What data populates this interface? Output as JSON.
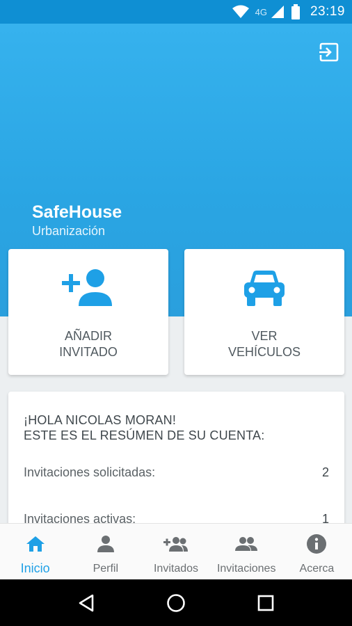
{
  "status_bar": {
    "network": "4G",
    "time": "23:19"
  },
  "header": {
    "app_name": "SafeHouse",
    "subtitle": "Urbanización"
  },
  "actions": [
    {
      "line1": "AÑADIR",
      "line2": "INVITADO",
      "icon": "add-person-icon"
    },
    {
      "line1": "VER",
      "line2": "VEHÍCULOS",
      "icon": "car-icon"
    }
  ],
  "summary": {
    "greeting_line1": "¡HOLA NICOLAS MORAN!",
    "greeting_line2": "ESTE ES EL RESÚMEN DE SU CUENTA:",
    "rows": [
      {
        "label": "Invitaciones solicitadas:",
        "value": "2"
      },
      {
        "label": "Invitaciones activas:",
        "value": "1"
      }
    ]
  },
  "bottom_nav": [
    {
      "label": "Inicio",
      "icon": "home-icon",
      "active": true
    },
    {
      "label": "Perfil",
      "icon": "person-icon"
    },
    {
      "label": "Invitados",
      "icon": "add-group-icon"
    },
    {
      "label": "Invitaciones",
      "icon": "group-icon"
    },
    {
      "label": "Acerca",
      "icon": "info-icon"
    }
  ],
  "colors": {
    "accent": "#1ea0e6",
    "hero": "#2aa5e3",
    "status_bar": "#0f8fd3"
  }
}
